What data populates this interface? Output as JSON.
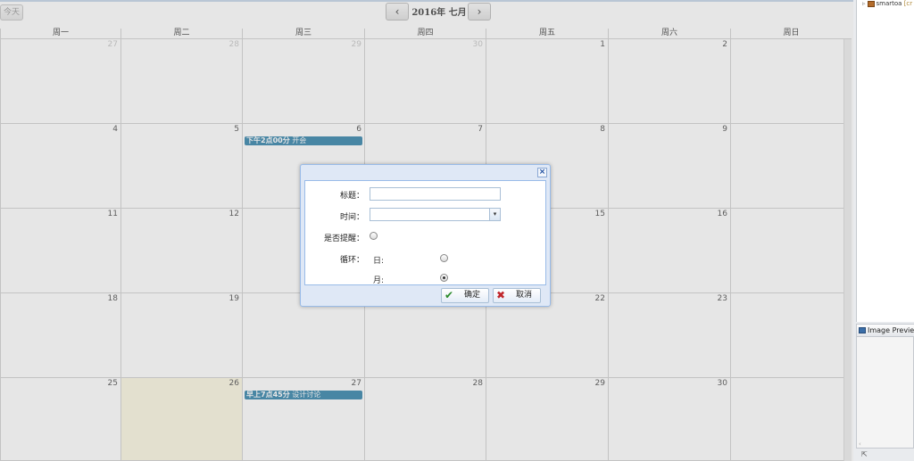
{
  "toolbar": {
    "today_label": "今天",
    "prev_label": "‹",
    "next_label": "›",
    "month_title": "2016年 七月"
  },
  "weekdays": [
    "周一",
    "周二",
    "周三",
    "周四",
    "周五",
    "周六",
    "周日"
  ],
  "weeks": [
    [
      "27",
      "28",
      "29",
      "30",
      "1",
      "2",
      ""
    ],
    [
      "4",
      "5",
      "6",
      "7",
      "8",
      "9",
      ""
    ],
    [
      "11",
      "12",
      "",
      "",
      "15",
      "16",
      ""
    ],
    [
      "18",
      "19",
      "",
      "",
      "22",
      "23",
      ""
    ],
    [
      "25",
      "26",
      "27",
      "28",
      "29",
      "30",
      ""
    ]
  ],
  "events": {
    "jul6": {
      "time": "下午2点00分",
      "title": "开会"
    },
    "jul27": {
      "time": "早上7点45分",
      "title": "设计讨论"
    }
  },
  "dialog": {
    "close_label": "×",
    "title_label": "标题：",
    "title_value": "",
    "time_label": "时间：",
    "time_value": "",
    "remind_label": "是否提醒：",
    "cycle_label": "循环：",
    "day_option": "日:",
    "month_option": "月:",
    "selected_cycle": "月",
    "ok_label": "确定",
    "cancel_label": "取消"
  },
  "ide": {
    "tree_item": "smartoa",
    "tree_suffix": "[cr",
    "preview_title": "Image Preview",
    "preview_scroll": "‹",
    "status_icon": "⇱"
  },
  "colors": {
    "event": "#3a87ad",
    "today_cell": "#fcf8e3",
    "dialog_bg": "#dfe8f6"
  }
}
